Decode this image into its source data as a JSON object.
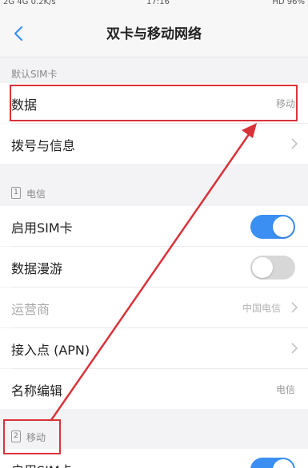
{
  "statusbar": {
    "left": "2G 4G 0.2K/s",
    "time": "17:16",
    "right": "HD 96%"
  },
  "header": {
    "title": "双卡与移动网络"
  },
  "default_sim": {
    "header": "默认SIM卡",
    "data_label": "数据",
    "data_value": "移动",
    "call_label": "拨号与信息"
  },
  "sim1": {
    "badge": "1",
    "carrier_name": "电信",
    "enable_label": "启用SIM卡",
    "enable_on": true,
    "roaming_label": "数据漫游",
    "roaming_on": false,
    "operator_label": "运营商",
    "operator_value": "中国电信",
    "apn_label": "接入点 (APN)",
    "name_edit_label": "名称编辑",
    "name_edit_value": "电信"
  },
  "sim2": {
    "badge": "2",
    "carrier_name": "移动",
    "enable_label": "启用SIM卡",
    "enable_on": true
  },
  "colors": {
    "accent": "#3b8ff3",
    "annotation": "#d9333a"
  }
}
